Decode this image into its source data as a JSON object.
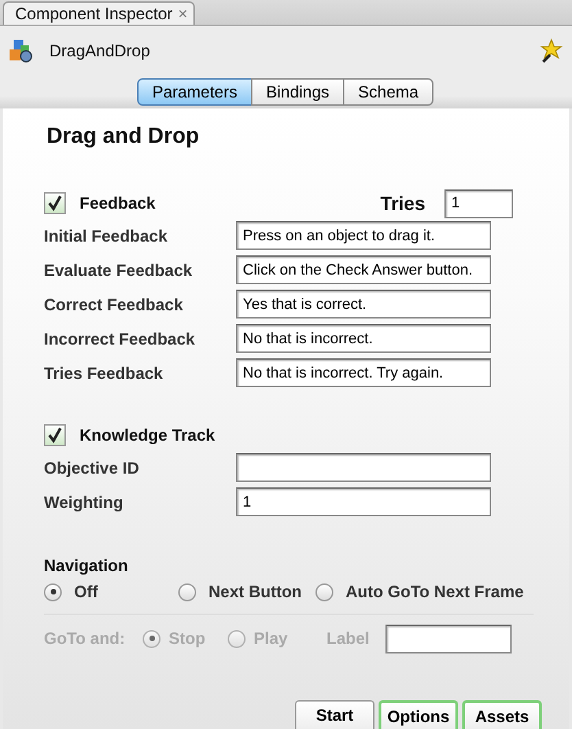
{
  "panel_tab": {
    "title": "Component Inspector",
    "close": "×"
  },
  "component": {
    "name": "DragAndDrop"
  },
  "tabs": [
    {
      "label": "Parameters",
      "selected": true
    },
    {
      "label": "Bindings",
      "selected": false
    },
    {
      "label": "Schema",
      "selected": false
    }
  ],
  "heading": "Drag and Drop",
  "feedback": {
    "label": "Feedback",
    "checked": true,
    "tries_label": "Tries",
    "tries_value": "1"
  },
  "feedback_fields": [
    {
      "label": "Initial Feedback",
      "value": "Press on an object to drag it."
    },
    {
      "label": "Evaluate Feedback",
      "value": "Click on the Check Answer button."
    },
    {
      "label": "Correct Feedback",
      "value": "Yes that is correct."
    },
    {
      "label": "Incorrect Feedback",
      "value": "No that is incorrect."
    },
    {
      "label": "Tries Feedback",
      "value": "No that is incorrect. Try again."
    }
  ],
  "knowledge_track": {
    "label": "Knowledge Track",
    "checked": true
  },
  "knowledge_fields": [
    {
      "label": "Objective ID"
    },
    {
      "label": "Weighting",
      "value": "1"
    }
  ],
  "navigation": {
    "label": "Navigation",
    "options": [
      {
        "label": "Off",
        "selected": true
      },
      {
        "label": "Next Button",
        "selected": false
      },
      {
        "label": "Auto GoTo Next Frame",
        "selected": false
      }
    ]
  },
  "goto": {
    "label": "GoTo and:",
    "disabled": true,
    "options": [
      {
        "label": "Stop",
        "selected": true
      },
      {
        "label": "Play",
        "selected": false
      }
    ],
    "label_field": "Label"
  },
  "bottom_tabs": [
    {
      "label": "Start",
      "highlighted": false
    },
    {
      "label": "Options",
      "highlighted": true
    },
    {
      "label": "Assets",
      "highlighted": true
    }
  ]
}
